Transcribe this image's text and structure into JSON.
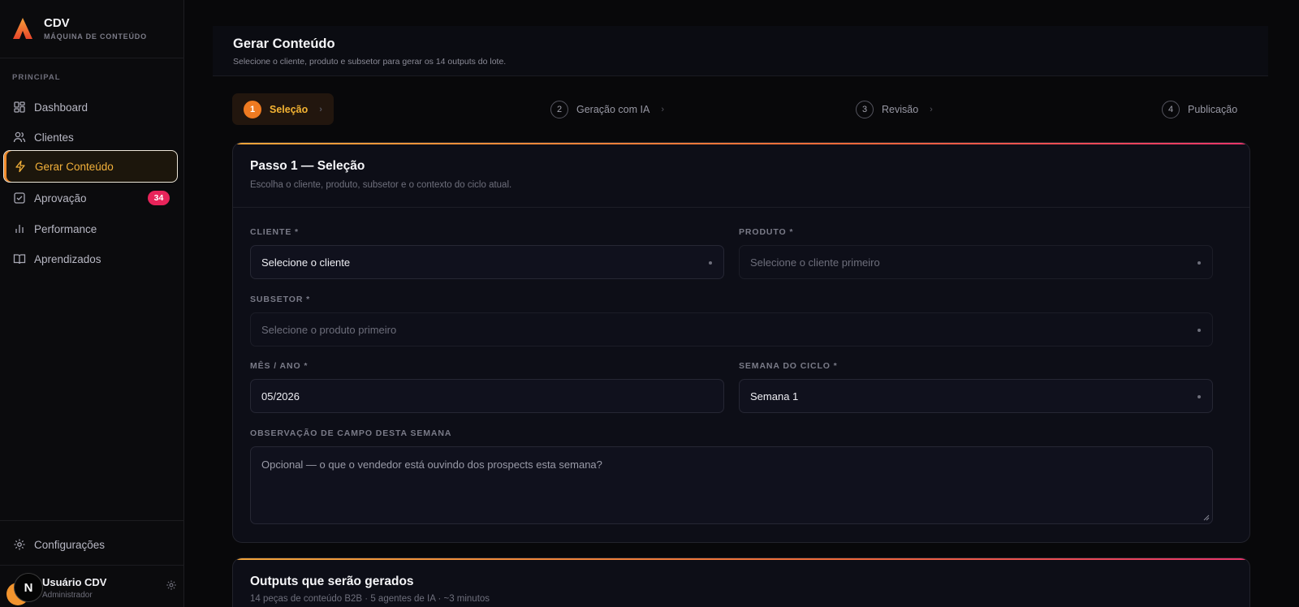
{
  "brand": {
    "name": "CDV",
    "subtitle": "MÁQUINA DE CONTEÚDO"
  },
  "sidebar": {
    "section": "PRINCIPAL",
    "items": [
      {
        "label": "Dashboard",
        "icon": "dashboard-icon"
      },
      {
        "label": "Clientes",
        "icon": "users-icon"
      },
      {
        "label": "Gerar Conteúdo",
        "icon": "bolt-icon",
        "active": true
      },
      {
        "label": "Aprovação",
        "icon": "check-square-icon",
        "badge": "34"
      },
      {
        "label": "Performance",
        "icon": "bar-chart-icon"
      },
      {
        "label": "Aprendizados",
        "icon": "book-icon"
      }
    ],
    "settings": "Configurações",
    "user": {
      "initial": "N",
      "name": "Usuário CDV",
      "role": "Administrador"
    }
  },
  "header": {
    "title": "Gerar Conteúdo",
    "subtitle": "Selecione o cliente, produto e subsetor para gerar os 14 outputs do lote."
  },
  "steps": [
    {
      "num": "1",
      "label": "Seleção",
      "active": true
    },
    {
      "num": "2",
      "label": "Geração com IA"
    },
    {
      "num": "3",
      "label": "Revisão"
    },
    {
      "num": "4",
      "label": "Publicação"
    }
  ],
  "step1": {
    "title": "Passo 1 — Seleção",
    "subtitle": "Escolha o cliente, produto, subsetor e o contexto do ciclo atual.",
    "cliente": {
      "label": "CLIENTE *",
      "value": "Selecione o cliente"
    },
    "produto": {
      "label": "PRODUTO *",
      "value": "Selecione o cliente primeiro"
    },
    "subsetor": {
      "label": "SUBSETOR *",
      "value": "Selecione o produto primeiro"
    },
    "mes_ano": {
      "label": "MÊS / ANO *",
      "value": "05/2026"
    },
    "semana": {
      "label": "SEMANA DO CICLO *",
      "value": "Semana 1"
    },
    "observacao": {
      "label": "OBSERVAÇÃO DE CAMPO DESTA SEMANA",
      "placeholder": "Opcional — o que o vendedor está ouvindo dos prospects esta semana?"
    }
  },
  "outputs": {
    "title": "Outputs que serão gerados",
    "subtitle": "14 peças de conteúdo B2B · 5 agentes de IA · ~3 minutos"
  },
  "colors": {
    "accent": "#f3b13a",
    "orange": "#ee7a21",
    "badge": "#e8245a",
    "bg": "#08080a"
  }
}
